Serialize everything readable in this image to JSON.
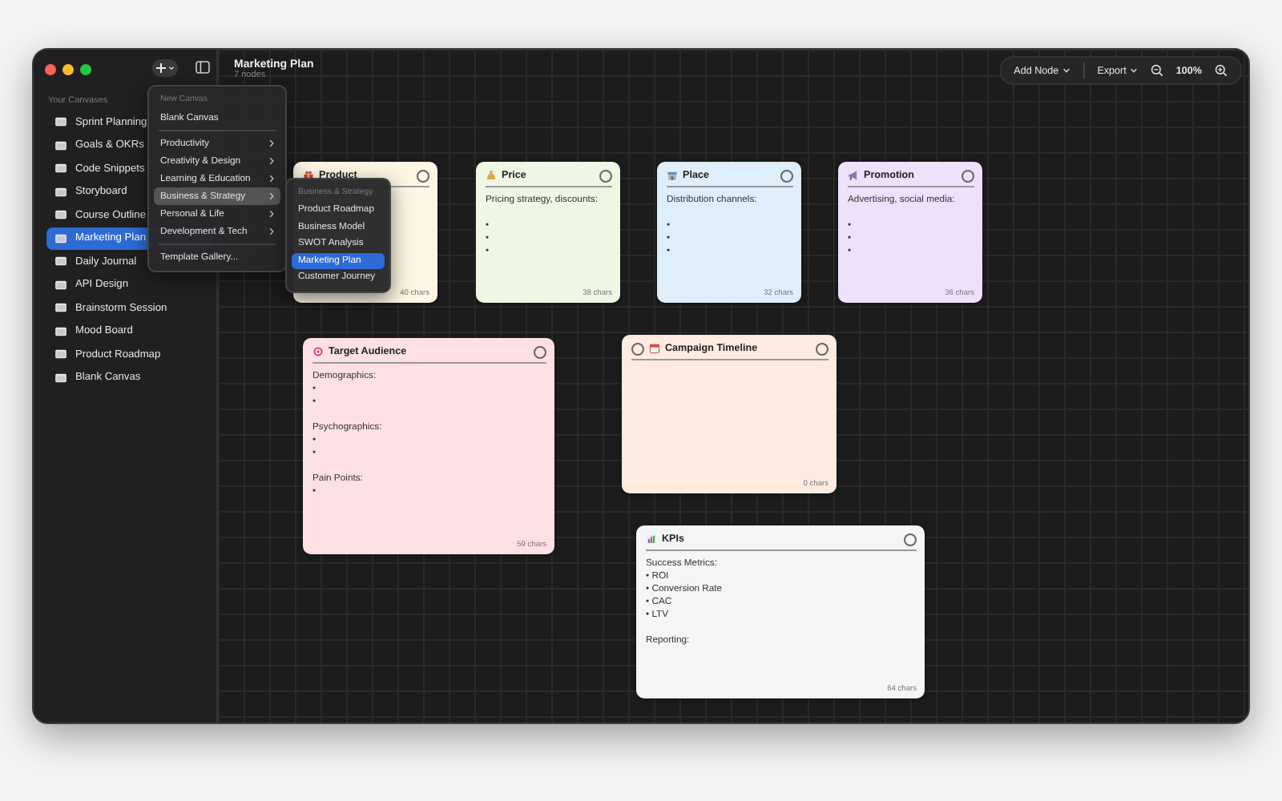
{
  "window": {
    "title": "Marketing Plan",
    "subtitle": "7 nodes"
  },
  "sidebar": {
    "header": "Your Canvases",
    "items": [
      {
        "label": "Sprint Planning",
        "selected": false
      },
      {
        "label": "Goals & OKRs",
        "selected": false
      },
      {
        "label": "Code Snippets",
        "selected": false
      },
      {
        "label": "Storyboard",
        "selected": false
      },
      {
        "label": "Course Outline",
        "selected": false
      },
      {
        "label": "Marketing Plan",
        "selected": true
      },
      {
        "label": "Daily Journal",
        "selected": false
      },
      {
        "label": "API Design",
        "selected": false
      },
      {
        "label": "Brainstorm Session",
        "selected": false
      },
      {
        "label": "Mood Board",
        "selected": false
      },
      {
        "label": "Product Roadmap",
        "selected": false
      },
      {
        "label": "Blank Canvas",
        "selected": false
      }
    ]
  },
  "toolbar": {
    "add_node": "Add Node",
    "export": "Export",
    "zoom": "100%"
  },
  "new_menu": {
    "items": [
      {
        "kind": "header",
        "label": "New Canvas"
      },
      {
        "kind": "item",
        "label": "Blank Canvas",
        "submenu": false,
        "selected": false
      },
      {
        "kind": "separator"
      },
      {
        "kind": "item",
        "label": "Productivity",
        "submenu": true,
        "selected": false
      },
      {
        "kind": "item",
        "label": "Creativity & Design",
        "submenu": true,
        "selected": false
      },
      {
        "kind": "item",
        "label": "Learning & Education",
        "submenu": true,
        "selected": false
      },
      {
        "kind": "item",
        "label": "Business & Strategy",
        "submenu": true,
        "selected": true
      },
      {
        "kind": "item",
        "label": "Personal & Life",
        "submenu": true,
        "selected": false
      },
      {
        "kind": "item",
        "label": "Development & Tech",
        "submenu": true,
        "selected": false
      },
      {
        "kind": "separator"
      },
      {
        "kind": "item",
        "label": "Template Gallery...",
        "submenu": false,
        "selected": false
      }
    ]
  },
  "submenu": {
    "header": "Business & Strategy",
    "items": [
      {
        "label": "Product Roadmap",
        "selected": false
      },
      {
        "label": "Business Model",
        "selected": false
      },
      {
        "label": "SWOT Analysis",
        "selected": false
      },
      {
        "label": "Marketing Plan",
        "selected": true
      },
      {
        "label": "Customer Journey",
        "selected": false
      }
    ]
  },
  "nodes": [
    {
      "title": "Product",
      "color": "#fdf6e3",
      "left_handle": false,
      "count": "40 chars"
    },
    {
      "title": "Price",
      "color": "#eef6e4",
      "left_handle": false,
      "body": [
        [
          "Pricing strategy, discounts:"
        ],
        [
          "•",
          "•",
          "•"
        ]
      ],
      "count": "38 chars"
    },
    {
      "title": "Place",
      "color": "#dfeefb",
      "left_handle": false,
      "body": [
        [
          "Distribution channels:"
        ],
        [
          "•",
          "•",
          "•"
        ]
      ],
      "count": "32 chars"
    },
    {
      "title": "Promotion",
      "color": "#efe0fb",
      "left_handle": false,
      "body": [
        [
          "Advertising, social media:"
        ],
        [
          "•",
          "•",
          "•"
        ]
      ],
      "count": "36 chars"
    },
    {
      "title": "Target Audience",
      "color": "#fde0e4",
      "left_handle": false,
      "body": [
        [
          "Demographics:",
          "•",
          "•"
        ],
        [
          "Psychographics:",
          "•",
          "•"
        ],
        [
          "Pain Points:",
          "•"
        ]
      ],
      "count": "59 chars"
    },
    {
      "title": "Campaign Timeline",
      "color": "#fdebdf",
      "left_handle": true,
      "count": "0 chars"
    },
    {
      "title": "KPIs",
      "color": "#f4f5f7",
      "left_handle": false,
      "body": [
        [
          "Success Metrics:",
          "• ROI",
          "• Conversion Rate",
          "• CAC",
          "• LTV"
        ],
        [
          "Reporting:"
        ]
      ],
      "count": "64 chars"
    }
  ]
}
